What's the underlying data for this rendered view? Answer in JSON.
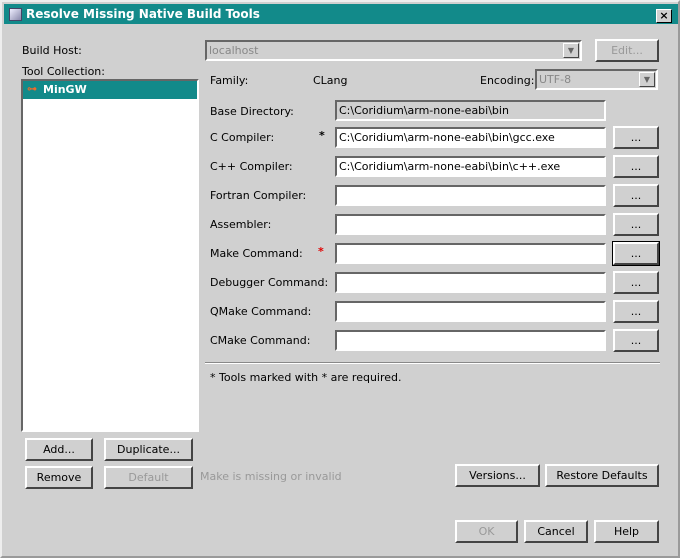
{
  "window": {
    "title": "Resolve Missing Native Build Tools"
  },
  "build_host": {
    "label": "Build Host:",
    "value": "localhost",
    "edit_label": "Edit..."
  },
  "tool_collection": {
    "label": "Tool Collection:",
    "items": [
      "MinGW"
    ]
  },
  "family": {
    "label": "Family:",
    "value": "CLang"
  },
  "encoding": {
    "label": "Encoding:",
    "value": "UTF-8"
  },
  "base_directory": {
    "label": "Base Directory:",
    "value": "C:\\Coridium\\arm-none-eabi\\bin"
  },
  "tools": [
    {
      "label": "C Compiler:",
      "value": "C:\\Coridium\\arm-none-eabi\\bin\\gcc.exe",
      "required": "*",
      "browse": "..."
    },
    {
      "label": "C++ Compiler:",
      "value": "C:\\Coridium\\arm-none-eabi\\bin\\c++.exe",
      "browse": "..."
    },
    {
      "label": "Fortran Compiler:",
      "value": "",
      "browse": "..."
    },
    {
      "label": "Assembler:",
      "value": "",
      "browse": "..."
    },
    {
      "label": "Make Command:",
      "value": "",
      "required": "*",
      "browse": "..."
    },
    {
      "label": "Debugger Command:",
      "value": "",
      "browse": "..."
    },
    {
      "label": "QMake Command:",
      "value": "",
      "browse": "..."
    },
    {
      "label": "CMake Command:",
      "value": "",
      "browse": "..."
    }
  ],
  "required_note": "* Tools marked with * are required.",
  "buttons": {
    "add": "Add...",
    "duplicate": "Duplicate...",
    "remove": "Remove",
    "default": "Default",
    "versions": "Versions...",
    "restore": "Restore Defaults",
    "ok": "OK",
    "cancel": "Cancel",
    "help": "Help"
  },
  "status_message": "Make is missing or invalid",
  "colors": {
    "title_bar": "#128a8a",
    "required_red": "#e00000"
  }
}
